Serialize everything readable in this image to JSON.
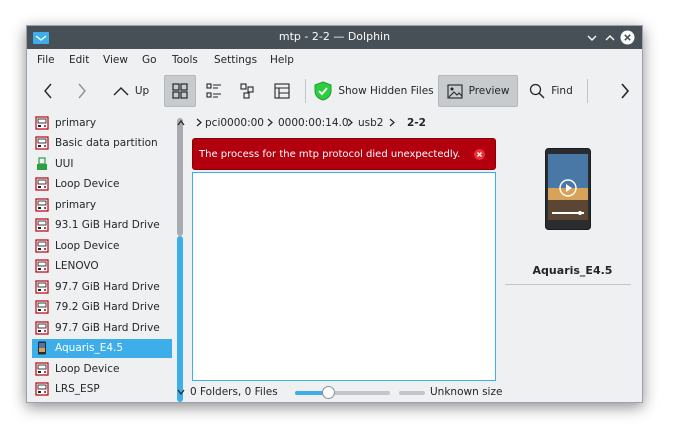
{
  "window": {
    "title": "mtp - 2-2 — Dolphin"
  },
  "menubar": {
    "items": [
      "File",
      "Edit",
      "View",
      "Go",
      "Tools",
      "Settings",
      "Help"
    ]
  },
  "toolbar": {
    "up_label": "Up",
    "show_hidden_label": "Show Hidden Files",
    "preview_label": "Preview",
    "find_label": "Find"
  },
  "places": {
    "items": [
      {
        "label": "primary",
        "icon": "drive-icon"
      },
      {
        "label": "Basic data partition",
        "icon": "drive-icon"
      },
      {
        "label": "UUI",
        "icon": "usb-icon"
      },
      {
        "label": "Loop Device",
        "icon": "drive-icon"
      },
      {
        "label": "primary",
        "icon": "drive-icon"
      },
      {
        "label": "93.1 GiB Hard Drive",
        "icon": "drive-icon"
      },
      {
        "label": "Loop Device",
        "icon": "drive-icon"
      },
      {
        "label": "LENOVO",
        "icon": "drive-icon"
      },
      {
        "label": "97.7 GiB Hard Drive",
        "icon": "drive-icon"
      },
      {
        "label": "79.2 GiB Hard Drive",
        "icon": "drive-icon"
      },
      {
        "label": "97.7 GiB Hard Drive",
        "icon": "drive-icon"
      },
      {
        "label": "Aquaris_E4.5",
        "icon": "phone-icon",
        "selected": true
      },
      {
        "label": "Loop Device",
        "icon": "drive-icon"
      },
      {
        "label": "LRS_ESP",
        "icon": "drive-icon"
      }
    ]
  },
  "breadcrumb": {
    "segments": [
      "pci0000:00",
      "0000:00:14.0",
      "usb2",
      "2-2"
    ]
  },
  "error": {
    "message": "The process for the mtp protocol died unexpectedly."
  },
  "status": {
    "summary": "0 Folders, 0 Files",
    "size_label": "Unknown size",
    "zoom": 0.35
  },
  "info": {
    "device_name": "Aquaris_E4.5"
  },
  "colors": {
    "selection": "#3daee9",
    "error_bg": "#b3000f",
    "titlebar": "#475057"
  }
}
